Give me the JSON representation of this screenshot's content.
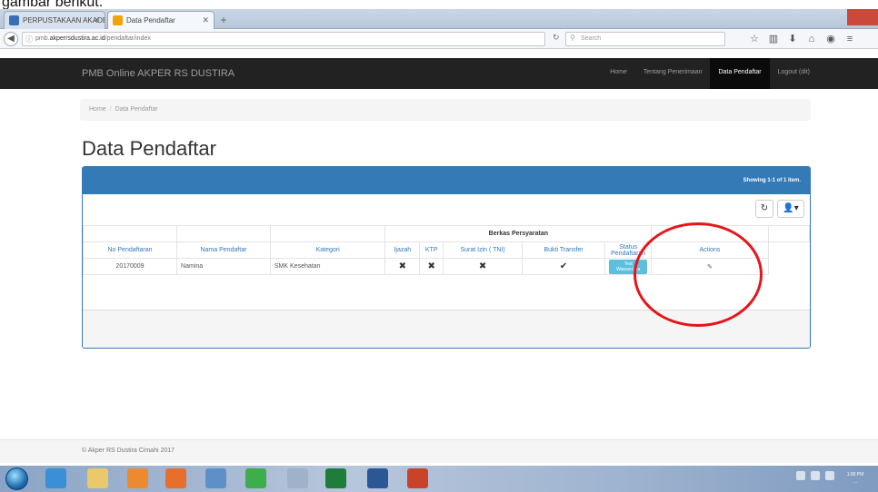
{
  "caption": "gambar berikut.",
  "browser": {
    "tabs": [
      {
        "title": "PERPUSTAKAAN AKADEMIK...",
        "active": false
      },
      {
        "title": "Data Pendaftar",
        "active": true
      }
    ],
    "new_tab": "+",
    "url_prefix": "pmb.",
    "url_host": "akperrsdustira.ac.id",
    "url_path": "/pendaftar/index",
    "search_placeholder": "Search"
  },
  "site": {
    "brand": "PMB Online AKPER RS DUSTIRA",
    "menu": [
      {
        "label": "Home",
        "active": false
      },
      {
        "label": "Tentang Penerimaan",
        "active": false
      },
      {
        "label": "Data Pendaftar",
        "active": true
      },
      {
        "label": "Logout (dit)",
        "active": false
      }
    ]
  },
  "breadcrumb": {
    "home": "Home",
    "current": "Data Pendaftar"
  },
  "page_title": "Data Pendaftar",
  "grid": {
    "summary": "Showing 1-1 of 1 item.",
    "group_header": "Berkas Persyaratan",
    "columns": {
      "no": "No Pendaftaran",
      "nama": "Nama Pendaftar",
      "kategori": "Kategori",
      "ijazah": "Ijazah",
      "ktp": "KTP",
      "surat_izin": "Surat Izin ( TNI)",
      "bukti_transfer": "Bukti Transfer",
      "status": "Status Pendaftaran",
      "actions": "Actions"
    },
    "rows": [
      {
        "no": "20170009",
        "nama": "Namina",
        "kategori": "SMK Kesehatan",
        "ijazah": "✖",
        "ktp": "✖",
        "surat_izin": "✖",
        "bukti_transfer": "✔",
        "status": "Test Wawancara",
        "action": "✎"
      }
    ]
  },
  "footer": "© Akper RS Dustira Cimahi 2017",
  "taskbar": {
    "clock_time": "1:00 PM",
    "clock_date": "..."
  },
  "colors": {
    "primary": "#337ab7",
    "navbar": "#222222",
    "badge_info": "#5bc0de",
    "highlight": "#e5161c"
  }
}
